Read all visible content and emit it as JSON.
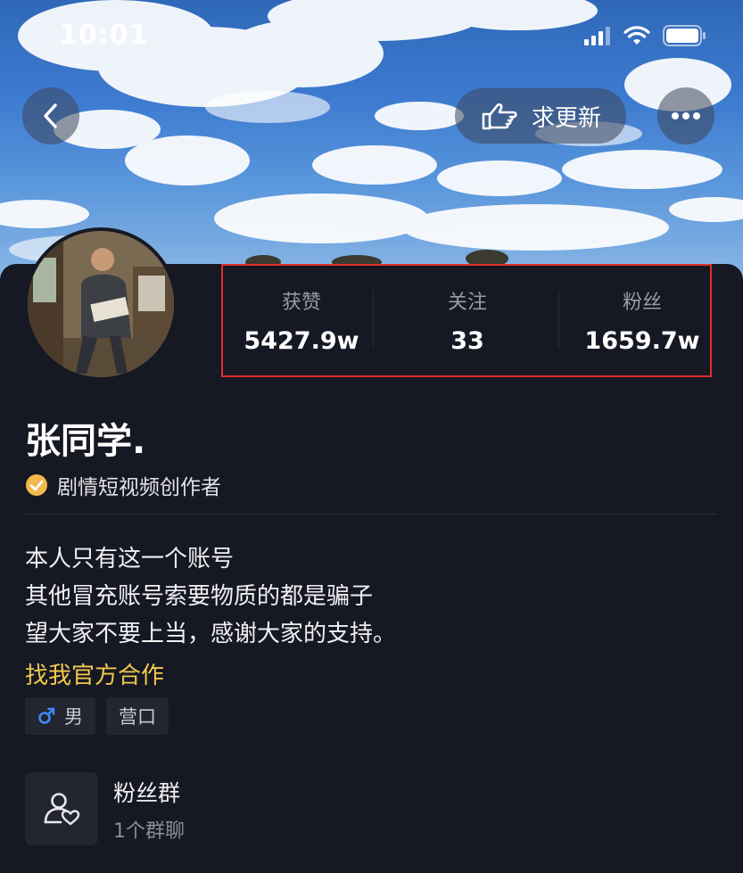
{
  "status_bar": {
    "time": "10:01"
  },
  "header": {
    "request_update_label": "求更新"
  },
  "stats": [
    {
      "label": "获赞",
      "value": "5427.9w"
    },
    {
      "label": "关注",
      "value": "33"
    },
    {
      "label": "粉丝",
      "value": "1659.7w"
    }
  ],
  "profile": {
    "name": "张同学.",
    "verification": "剧情短视频创作者",
    "bio_lines": [
      "本人只有这一个账号",
      "其他冒充账号索要物质的都是骗子",
      "望大家不要上当，感谢大家的支持。"
    ],
    "cooperation_link": "找我官方合作",
    "tags": [
      {
        "icon": "male-icon",
        "label": "男"
      },
      {
        "label": "营口"
      }
    ]
  },
  "fan_group": {
    "title": "粉丝群",
    "subtitle": "1个群聊"
  },
  "colors": {
    "highlight_border": "#e0302a",
    "link": "#f2c94c",
    "verify_badge": "#f2b84b"
  }
}
